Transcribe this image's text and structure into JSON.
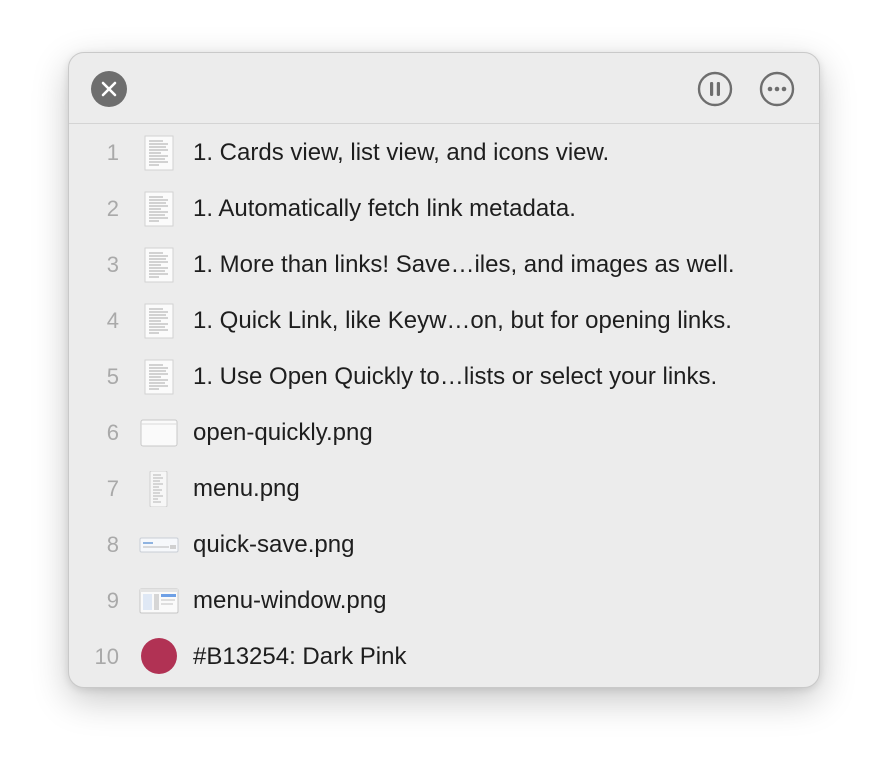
{
  "toolbar": {
    "close_icon": "close-icon",
    "pause_icon": "pause-icon",
    "more_icon": "ellipsis-icon"
  },
  "items": [
    {
      "index": "1",
      "kind": "document",
      "label": "1. Cards view, list view, and icons view."
    },
    {
      "index": "2",
      "kind": "document",
      "label": "1. Automatically fetch link metadata."
    },
    {
      "index": "3",
      "kind": "document",
      "label": "1. More than links! Save…iles, and images as well."
    },
    {
      "index": "4",
      "kind": "document",
      "label": "1. Quick Link, like Keyw…on, but for opening links."
    },
    {
      "index": "5",
      "kind": "document",
      "label": "1. Use Open Quickly to…lists or select your links."
    },
    {
      "index": "6",
      "kind": "image",
      "label": "open-quickly.png"
    },
    {
      "index": "7",
      "kind": "image",
      "label": "menu.png"
    },
    {
      "index": "8",
      "kind": "image",
      "label": "quick-save.png"
    },
    {
      "index": "9",
      "kind": "image",
      "label": "menu-window.png"
    },
    {
      "index": "10",
      "kind": "color",
      "label": "#B13254: Dark Pink",
      "color": "#B13254"
    }
  ],
  "colors": {
    "panel_bg": "#ececec",
    "index_text": "#a9a9a9",
    "label_text": "#1e1e1e",
    "swatch": "#B13254"
  }
}
